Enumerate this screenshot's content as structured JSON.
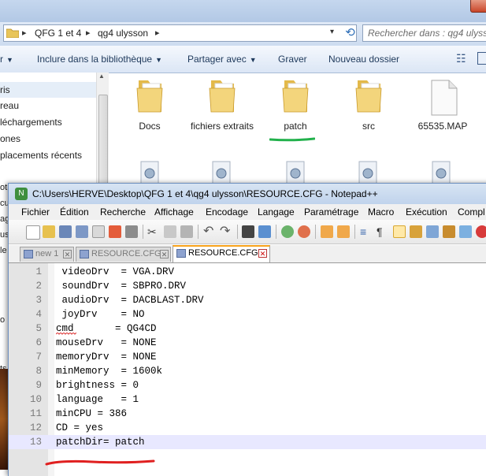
{
  "explorer": {
    "breadcrumbs": [
      "QFG 1 et 4",
      "qg4 ulysson"
    ],
    "search_placeholder": "Rechercher dans : qg4 ulysson",
    "toolbar": {
      "organize_partial": "r",
      "include_library": "Inclure dans la bibliothèque",
      "share_with": "Partager avec",
      "burn": "Graver",
      "new_folder": "Nouveau dossier"
    },
    "nav_items": [
      "ris",
      "reau",
      "léchargements",
      "ones",
      "placements récents"
    ],
    "edge_letters": [
      "ot",
      "cu",
      "ag",
      "us",
      "le",
      "o",
      "ts"
    ],
    "files": [
      {
        "name": "Docs",
        "type": "folder"
      },
      {
        "name": "fichiers extraits",
        "type": "folder"
      },
      {
        "name": "patch",
        "type": "folder"
      },
      {
        "name": "src",
        "type": "folder"
      },
      {
        "name": "65535.MAP",
        "type": "file"
      }
    ],
    "annotation_color": "#22b14c"
  },
  "notepad": {
    "title": "C:\\Users\\HERVE\\Desktop\\QFG 1 et 4\\qg4 ulysson\\RESOURCE.CFG - Notepad++",
    "menu": [
      "Fichier",
      "Édition",
      "Recherche",
      "Affichage",
      "Encodage",
      "Langage",
      "Paramétrage",
      "Macro",
      "Exécution",
      "Compl"
    ],
    "tabs": [
      {
        "label": "new 1",
        "active": false
      },
      {
        "label": "RESOURCE.CFG",
        "active": false
      },
      {
        "label": "RESOURCE.CFG",
        "active": true
      }
    ],
    "lines": [
      {
        "num": "1",
        "text": " videoDrv  = VGA.DRV"
      },
      {
        "num": "2",
        "text": " soundDrv  = SBPRO.DRV"
      },
      {
        "num": "3",
        "text": " audioDrv  = DACBLAST.DRV"
      },
      {
        "num": "4",
        "text": " joyDrv    = NO"
      },
      {
        "num": "5",
        "text": "cmd       = QG4CD"
      },
      {
        "num": "6",
        "text": "mouseDrv   = NONE"
      },
      {
        "num": "7",
        "text": "memoryDrv  = NONE"
      },
      {
        "num": "8",
        "text": "minMemory  = 1600k"
      },
      {
        "num": "9",
        "text": "brightness = 0"
      },
      {
        "num": "10",
        "text": "language   = 1"
      },
      {
        "num": "11",
        "text": "minCPU = 386"
      },
      {
        "num": "12",
        "text": "CD = yes"
      },
      {
        "num": "13",
        "text": "patchDir= patch"
      }
    ],
    "annotation_color": "#e02020"
  }
}
